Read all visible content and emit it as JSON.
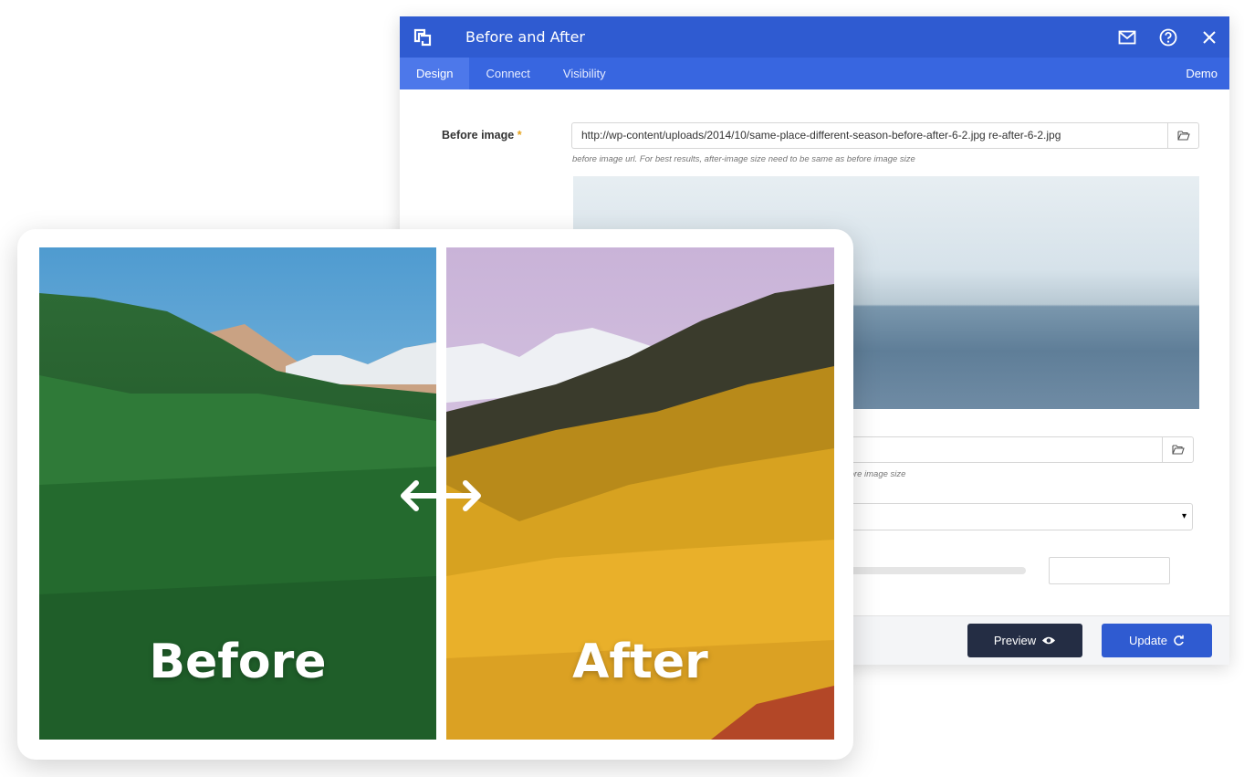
{
  "editor": {
    "title": "Before and After",
    "tabs": [
      "Design",
      "Connect",
      "Visibility"
    ],
    "active_tab": "Design",
    "demo_label": "Demo",
    "before_image": {
      "label": "Before image",
      "required_mark": "*",
      "url": "http://wp-content/uploads/2014/10/same-place-different-season-before-after-6-2.jpg re-after-6-2.jpg",
      "hint": "before image url. For best results, after-image size need to be same as before image size"
    },
    "after_image": {
      "hint_fragment": "fore image size"
    },
    "select_caret": "▾",
    "footer": {
      "preview_label": "Preview",
      "update_label": "Update"
    }
  },
  "card": {
    "before_label": "Before",
    "after_label": "After"
  },
  "icons": {
    "app_logo": "app-logo-icon",
    "mail": "mail-icon",
    "help": "help-icon",
    "close": "close-icon",
    "folder": "folder-open-icon",
    "eye": "eye-icon",
    "refresh": "refresh-icon",
    "compare": "double-arrow-icon"
  },
  "colors": {
    "header": "#2f5bd1",
    "tabbar": "#3866e0",
    "preview_button": "#242d44",
    "update_button": "#2f5bd1",
    "required": "#e6a21a"
  }
}
